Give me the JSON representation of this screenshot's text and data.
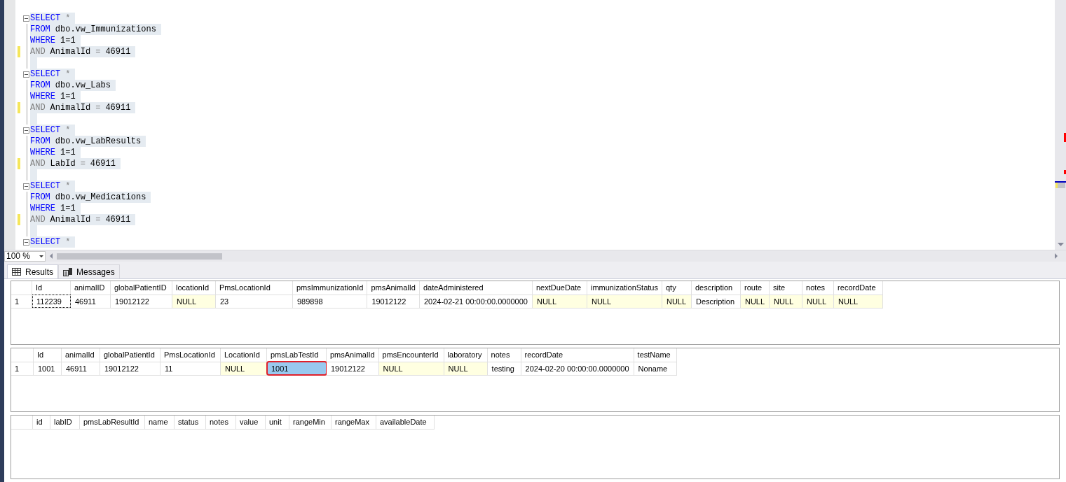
{
  "editor": {
    "lines": [
      {
        "kind": "code",
        "fold": true,
        "changed": false,
        "tokens": [
          {
            "kind": "keyword",
            "text": "SELECT"
          },
          {
            "kind": "operator",
            "text": "*"
          }
        ]
      },
      {
        "kind": "code",
        "fold": false,
        "changed": false,
        "tokens": [
          {
            "kind": "keyword",
            "text": "FROM"
          },
          {
            "kind": "plain",
            "text": "dbo.vw_Immunizations"
          }
        ]
      },
      {
        "kind": "code",
        "fold": false,
        "changed": false,
        "tokens": [
          {
            "kind": "keyword",
            "text": "WHERE"
          },
          {
            "kind": "plain",
            "text": "1=1"
          }
        ]
      },
      {
        "kind": "code",
        "fold": false,
        "changed": true,
        "tokens": [
          {
            "kind": "operator",
            "text": "AND"
          },
          {
            "kind": "plain",
            "text": "AnimalId"
          },
          {
            "kind": "operator",
            "text": "="
          },
          {
            "kind": "plain",
            "text": "46911"
          }
        ]
      },
      {
        "kind": "blank"
      },
      {
        "kind": "code",
        "fold": true,
        "changed": false,
        "tokens": [
          {
            "kind": "keyword",
            "text": "SELECT"
          },
          {
            "kind": "operator",
            "text": "*"
          }
        ]
      },
      {
        "kind": "code",
        "fold": false,
        "changed": false,
        "tokens": [
          {
            "kind": "keyword",
            "text": "FROM"
          },
          {
            "kind": "plain",
            "text": "dbo.vw_Labs"
          }
        ]
      },
      {
        "kind": "code",
        "fold": false,
        "changed": false,
        "tokens": [
          {
            "kind": "keyword",
            "text": "WHERE"
          },
          {
            "kind": "plain",
            "text": "1=1"
          }
        ]
      },
      {
        "kind": "code",
        "fold": false,
        "changed": true,
        "tokens": [
          {
            "kind": "operator",
            "text": "AND"
          },
          {
            "kind": "plain",
            "text": "AnimalId"
          },
          {
            "kind": "operator",
            "text": "="
          },
          {
            "kind": "plain",
            "text": "46911"
          }
        ]
      },
      {
        "kind": "blank"
      },
      {
        "kind": "code",
        "fold": true,
        "changed": false,
        "tokens": [
          {
            "kind": "keyword",
            "text": "SELECT"
          },
          {
            "kind": "operator",
            "text": "*"
          }
        ]
      },
      {
        "kind": "code",
        "fold": false,
        "changed": false,
        "tokens": [
          {
            "kind": "keyword",
            "text": "FROM"
          },
          {
            "kind": "plain",
            "text": "dbo.vw_LabResults"
          }
        ]
      },
      {
        "kind": "code",
        "fold": false,
        "changed": false,
        "tokens": [
          {
            "kind": "keyword",
            "text": "WHERE"
          },
          {
            "kind": "plain",
            "text": "1=1"
          }
        ]
      },
      {
        "kind": "code",
        "fold": false,
        "changed": true,
        "tokens": [
          {
            "kind": "operator",
            "text": "AND"
          },
          {
            "kind": "plain",
            "text": "LabId"
          },
          {
            "kind": "operator",
            "text": "="
          },
          {
            "kind": "plain",
            "text": "46911"
          }
        ]
      },
      {
        "kind": "blank"
      },
      {
        "kind": "code",
        "fold": true,
        "changed": false,
        "tokens": [
          {
            "kind": "keyword",
            "text": "SELECT"
          },
          {
            "kind": "operator",
            "text": "*"
          }
        ]
      },
      {
        "kind": "code",
        "fold": false,
        "changed": false,
        "tokens": [
          {
            "kind": "keyword",
            "text": "FROM"
          },
          {
            "kind": "plain",
            "text": "dbo.vw_Medications"
          }
        ]
      },
      {
        "kind": "code",
        "fold": false,
        "changed": false,
        "tokens": [
          {
            "kind": "keyword",
            "text": "WHERE"
          },
          {
            "kind": "plain",
            "text": "1=1"
          }
        ]
      },
      {
        "kind": "code",
        "fold": false,
        "changed": true,
        "tokens": [
          {
            "kind": "operator",
            "text": "AND"
          },
          {
            "kind": "plain",
            "text": "AnimalId"
          },
          {
            "kind": "operator",
            "text": "="
          },
          {
            "kind": "plain",
            "text": "46911"
          }
        ]
      },
      {
        "kind": "blank"
      },
      {
        "kind": "code",
        "fold": true,
        "changed": false,
        "tokens": [
          {
            "kind": "keyword",
            "text": "SELECT"
          },
          {
            "kind": "operator",
            "text": "*"
          }
        ]
      }
    ]
  },
  "zoom": {
    "value": "100 %"
  },
  "tabs": [
    {
      "label": "Results",
      "selected": true
    },
    {
      "label": "Messages",
      "selected": false
    }
  ],
  "grids": [
    {
      "columns": [
        "Id",
        "animalID",
        "globalPatientID",
        "locationId",
        "PmsLocationId",
        "pmsImmunizationId",
        "pmsAnimalId",
        "dateAdministered",
        "nextDueDate",
        "immunizationStatus",
        "qty",
        "description",
        "route",
        "site",
        "notes",
        "recordDate"
      ],
      "rows": [
        {
          "number": "1",
          "cells": [
            {
              "text": "112239",
              "null": false,
              "focused": true,
              "selected": false
            },
            {
              "text": "46911",
              "null": false,
              "focused": false,
              "selected": false
            },
            {
              "text": "19012122",
              "null": false,
              "focused": false,
              "selected": false
            },
            {
              "text": "NULL",
              "null": true,
              "focused": false,
              "selected": false
            },
            {
              "text": "23",
              "null": false,
              "focused": false,
              "selected": false
            },
            {
              "text": "989898",
              "null": false,
              "focused": false,
              "selected": false
            },
            {
              "text": "19012122",
              "null": false,
              "focused": false,
              "selected": false
            },
            {
              "text": "2024-02-21 00:00:00.0000000",
              "null": false,
              "focused": false,
              "selected": false
            },
            {
              "text": "NULL",
              "null": true,
              "focused": false,
              "selected": false
            },
            {
              "text": "NULL",
              "null": true,
              "focused": false,
              "selected": false
            },
            {
              "text": "NULL",
              "null": true,
              "focused": false,
              "selected": false
            },
            {
              "text": "Description",
              "null": false,
              "focused": false,
              "selected": false
            },
            {
              "text": "NULL",
              "null": true,
              "focused": false,
              "selected": false
            },
            {
              "text": "NULL",
              "null": true,
              "focused": false,
              "selected": false
            },
            {
              "text": "NULL",
              "null": true,
              "focused": false,
              "selected": false
            },
            {
              "text": "NULL",
              "null": true,
              "focused": false,
              "selected": false
            }
          ]
        }
      ]
    },
    {
      "columns": [
        "Id",
        "animalId",
        "globalPatientId",
        "PmsLocationId",
        "LocationId",
        "pmsLabTestId",
        "pmsAnimalId",
        "pmsEncounterId",
        "laboratory",
        "notes",
        "recordDate",
        "testName"
      ],
      "rows": [
        {
          "number": "1",
          "cells": [
            {
              "text": "1001",
              "null": false,
              "focused": false,
              "selected": false
            },
            {
              "text": "46911",
              "null": false,
              "focused": false,
              "selected": false
            },
            {
              "text": "19012122",
              "null": false,
              "focused": false,
              "selected": false
            },
            {
              "text": "11",
              "null": false,
              "focused": false,
              "selected": false
            },
            {
              "text": "NULL",
              "null": true,
              "focused": false,
              "selected": false
            },
            {
              "text": "1001",
              "null": false,
              "focused": false,
              "selected": true
            },
            {
              "text": "19012122",
              "null": false,
              "focused": false,
              "selected": false
            },
            {
              "text": "NULL",
              "null": true,
              "focused": false,
              "selected": false
            },
            {
              "text": "NULL",
              "null": true,
              "focused": false,
              "selected": false
            },
            {
              "text": "testing",
              "null": false,
              "focused": false,
              "selected": false
            },
            {
              "text": "2024-02-20 00:00:00.0000000",
              "null": false,
              "focused": false,
              "selected": false
            },
            {
              "text": "Noname",
              "null": false,
              "focused": false,
              "selected": false
            }
          ]
        }
      ]
    },
    {
      "columns": [
        "id",
        "labID",
        "pmsLabResultId",
        "name",
        "status",
        "notes",
        "value",
        "unit",
        "rangeMin",
        "rangeMax",
        "availableDate"
      ]
    }
  ]
}
